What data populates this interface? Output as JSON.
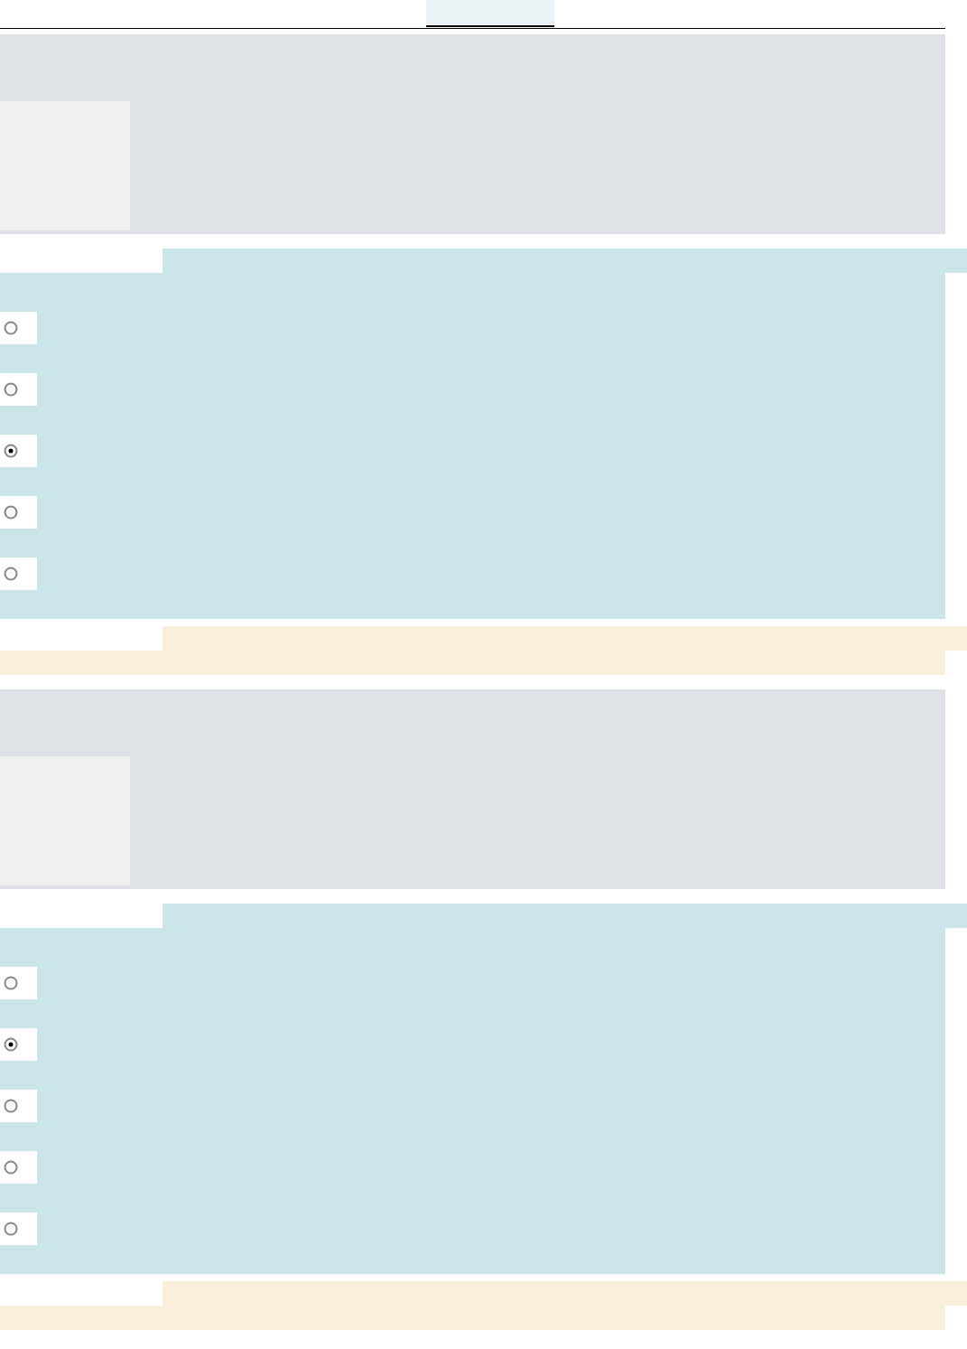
{
  "tab": {
    "selected": true
  },
  "questions": [
    {
      "options": [
        {
          "selected": false
        },
        {
          "selected": false
        },
        {
          "selected": true
        },
        {
          "selected": false
        },
        {
          "selected": false
        }
      ]
    },
    {
      "options": [
        {
          "selected": false
        },
        {
          "selected": true
        },
        {
          "selected": false
        },
        {
          "selected": false
        },
        {
          "selected": false
        }
      ]
    }
  ]
}
